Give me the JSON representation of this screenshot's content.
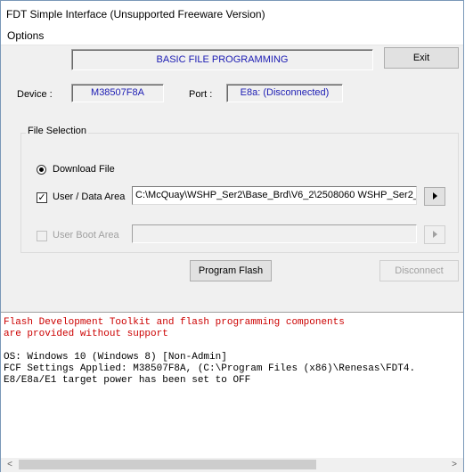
{
  "window": {
    "title": "FDT Simple Interface   (Unsupported Freeware Version)"
  },
  "menu": {
    "options": "Options"
  },
  "header": {
    "banner": "BASIC FILE PROGRAMMING",
    "exit_label": "Exit"
  },
  "device": {
    "device_label": "Device :",
    "device_value": "M38507F8A",
    "port_label": "Port :",
    "port_value": "E8a: (Disconnected)"
  },
  "file_selection": {
    "title": "File Selection",
    "download_file_label": "Download File",
    "download_file_selected": true,
    "user_data_area_label": "User / Data Area",
    "user_data_area_checked": true,
    "user_data_area_path": "C:\\McQuay\\WSHP_Ser2\\Base_Brd\\V6_2\\2508060 WSHP_Ser2_",
    "user_boot_area_label": "User Boot Area",
    "user_boot_area_checked": false,
    "user_boot_area_path": ""
  },
  "actions": {
    "program_flash_label": "Program Flash",
    "disconnect_label": "Disconnect"
  },
  "log": {
    "lines": [
      {
        "text": "Flash Development Toolkit and flash programming components",
        "color": "#cc0000"
      },
      {
        "text": "are provided without support",
        "color": "#cc0000"
      },
      {
        "text": "",
        "color": "#000000"
      },
      {
        "text": "OS: Windows 10 (Windows 8) [Non-Admin]",
        "color": "#000000"
      },
      {
        "text": "FCF Settings Applied: M38507F8A, (C:\\Program Files (x86)\\Renesas\\FDT4.",
        "color": "#000000"
      },
      {
        "text": "E8/E8a/E1 target power has been set to OFF",
        "color": "#000000"
      }
    ]
  },
  "icons": {
    "browse_user_data": "play-arrow-icon",
    "browse_user_boot": "play-arrow-icon",
    "scroll_left": "chevron-left-icon",
    "scroll_right": "chevron-right-icon"
  }
}
